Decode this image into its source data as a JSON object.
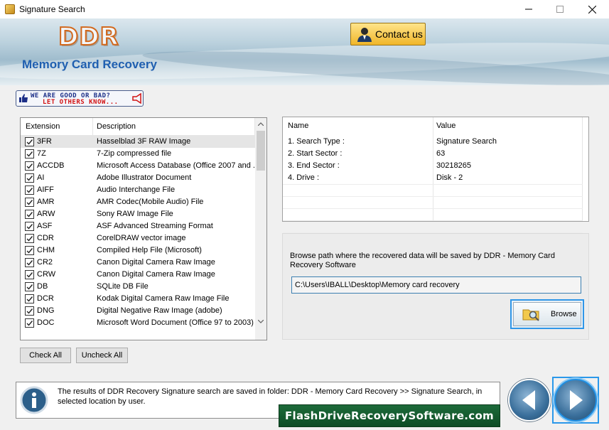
{
  "window": {
    "title": "Signature Search"
  },
  "header": {
    "logo": "DDR",
    "subtitle": "Memory Card Recovery",
    "contact_label": "Contact us"
  },
  "feedback": {
    "line1": "WE ARE GOOD OR BAD?",
    "line2": "LET OTHERS KNOW..."
  },
  "extensions": {
    "columns": [
      "Extension",
      "Description"
    ],
    "rows": [
      {
        "ext": "3FR",
        "desc": "Hasselblad 3F RAW Image",
        "checked": true
      },
      {
        "ext": "7Z",
        "desc": "7-Zip compressed file",
        "checked": true
      },
      {
        "ext": "ACCDB",
        "desc": "Microsoft Access Database (Office 2007 and ...",
        "checked": true
      },
      {
        "ext": "AI",
        "desc": "Adobe Illustrator Document",
        "checked": true
      },
      {
        "ext": "AIFF",
        "desc": "Audio Interchange File",
        "checked": true
      },
      {
        "ext": "AMR",
        "desc": "AMR Codec(Mobile Audio) File",
        "checked": true
      },
      {
        "ext": "ARW",
        "desc": "Sony RAW Image File",
        "checked": true
      },
      {
        "ext": "ASF",
        "desc": "ASF Advanced Streaming Format",
        "checked": true
      },
      {
        "ext": "CDR",
        "desc": "CorelDRAW vector image",
        "checked": true
      },
      {
        "ext": "CHM",
        "desc": "Compiled Help File (Microsoft)",
        "checked": true
      },
      {
        "ext": "CR2",
        "desc": "Canon Digital Camera Raw Image",
        "checked": true
      },
      {
        "ext": "CRW",
        "desc": "Canon Digital Camera Raw Image",
        "checked": true
      },
      {
        "ext": "DB",
        "desc": "SQLite DB File",
        "checked": true
      },
      {
        "ext": "DCR",
        "desc": "Kodak Digital Camera Raw Image File",
        "checked": true
      },
      {
        "ext": "DNG",
        "desc": "Digital Negative Raw Image (adobe)",
        "checked": true
      },
      {
        "ext": "DOC",
        "desc": "Microsoft Word Document (Office 97 to 2003)",
        "checked": true
      }
    ],
    "check_all_label": "Check All",
    "uncheck_all_label": "Uncheck All"
  },
  "info_table": {
    "columns": [
      "Name",
      "Value"
    ],
    "rows": [
      {
        "name": "1. Search Type :",
        "value": "Signature Search"
      },
      {
        "name": "2. Start Sector :",
        "value": "63"
      },
      {
        "name": "3. End Sector :",
        "value": "30218265"
      },
      {
        "name": "4. Drive :",
        "value": "Disk - 2"
      }
    ]
  },
  "browse": {
    "description": "Browse path where the recovered data will be saved by DDR - Memory Card Recovery Software",
    "path_value": "C:\\Users\\IBALL\\Desktop\\Memory card recovery",
    "button_label": "Browse"
  },
  "status": {
    "message": "The results of DDR Recovery Signature search are saved in folder: DDR - Memory Card Recovery  >> Signature Search, in selected location by user."
  },
  "watermark": "FlashDriveRecoverySoftware.com",
  "colors": {
    "accent": "#1f5fb0",
    "focus": "#2f96e8",
    "logo_outline": "#d2691e"
  }
}
